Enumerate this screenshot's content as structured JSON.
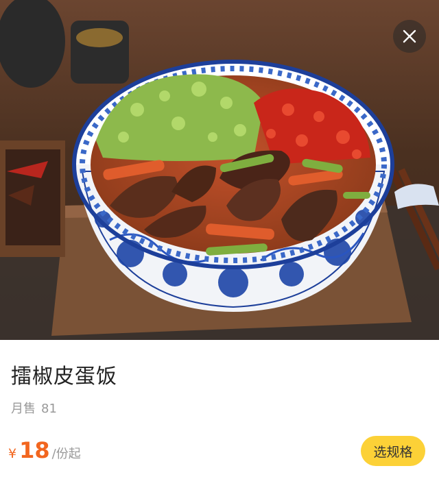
{
  "product": {
    "name": "擂椒皮蛋饭",
    "sales_label": "月售",
    "sales_count": "81",
    "currency_symbol": "¥",
    "price": "18",
    "price_unit": "/份起",
    "select_spec_label": "选规格"
  },
  "colors": {
    "accent": "#f2661f",
    "button_bg": "#fcd137",
    "muted_text": "#999999"
  },
  "icons": {
    "close": "close-icon"
  }
}
